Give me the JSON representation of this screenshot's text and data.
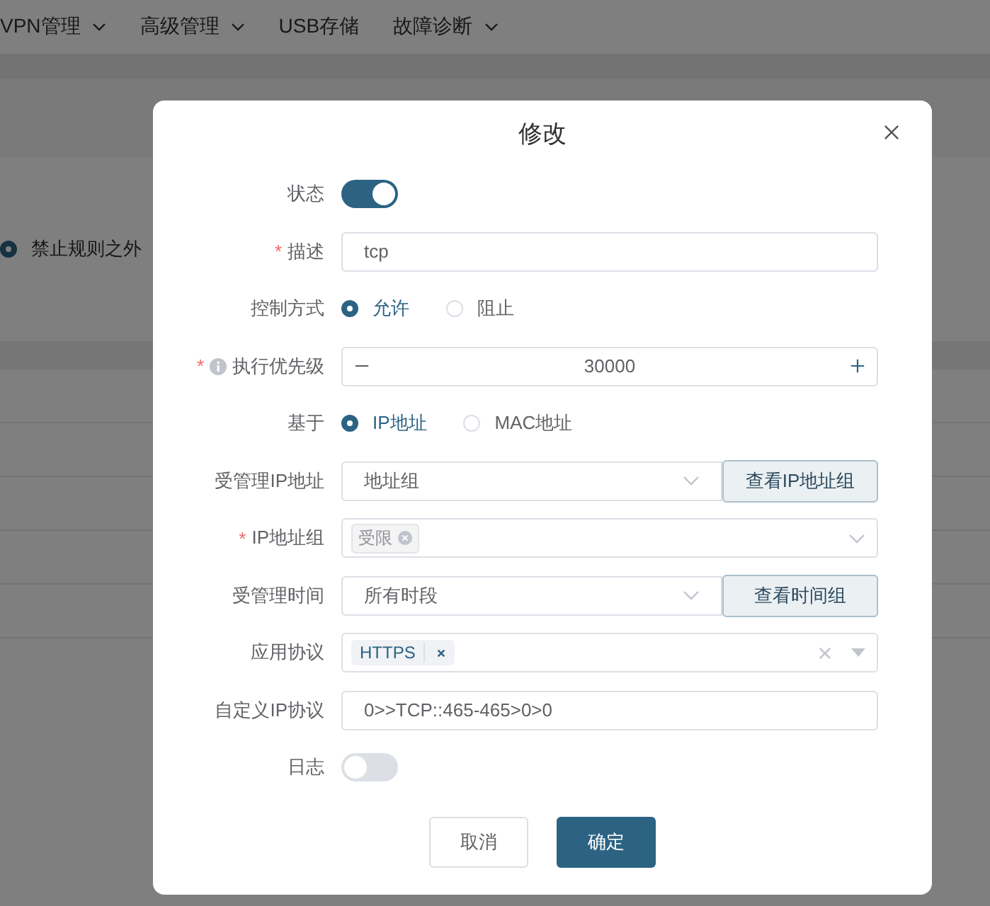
{
  "nav": [
    {
      "label": "VPN管理",
      "dropdown": true
    },
    {
      "label": "高级管理",
      "dropdown": true
    },
    {
      "label": "USB存储",
      "dropdown": false
    },
    {
      "label": "故障诊断",
      "dropdown": true
    }
  ],
  "background": {
    "radio": {
      "label": "禁止规则之外",
      "selected": true
    }
  },
  "dialog": {
    "title": "修改",
    "fields": [
      {
        "kind": "switch",
        "label": "状态",
        "on": true
      },
      {
        "kind": "text",
        "label": "描述",
        "required_mark": "*",
        "value": "tcp"
      },
      {
        "kind": "radio",
        "label": "控制方式",
        "options": [
          {
            "label": "允许",
            "selected": true
          },
          {
            "label": "阻止",
            "selected": false
          }
        ]
      },
      {
        "kind": "number",
        "label": "执行优先级",
        "required_mark": "*",
        "info": true,
        "value": "30000"
      },
      {
        "kind": "radio",
        "label": "基于",
        "options": [
          {
            "label": "IP地址",
            "selected": true
          },
          {
            "label": "MAC地址",
            "selected": false
          }
        ]
      },
      {
        "kind": "select_button",
        "label": "受管理IP地址",
        "value": "地址组",
        "button": "查看IP地址组"
      },
      {
        "kind": "tags",
        "label": "IP地址组",
        "required_mark": "*",
        "tags": [
          "受限"
        ]
      },
      {
        "kind": "select_button",
        "label": "受管理时间",
        "value": "所有时段",
        "button": "查看时间组"
      },
      {
        "kind": "protocol",
        "label": "应用协议",
        "tags": [
          "HTTPS"
        ]
      },
      {
        "kind": "text",
        "label": "自定义IP协议",
        "value": "0>>TCP::465-465>0>0"
      },
      {
        "kind": "switch",
        "label": "日志",
        "on": false
      }
    ],
    "buttons": [
      {
        "label": "取消",
        "kind": "secondary"
      },
      {
        "label": "确定",
        "kind": "primary"
      }
    ]
  }
}
